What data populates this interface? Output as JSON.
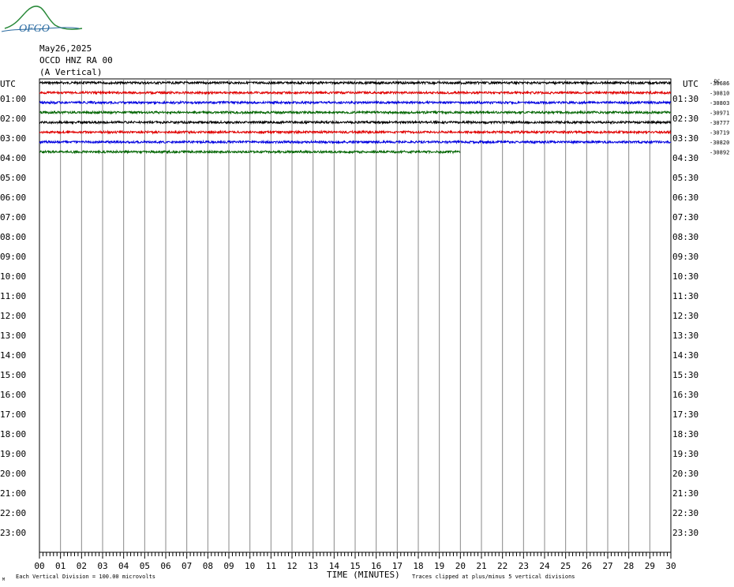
{
  "logo": {
    "text": "OFGO"
  },
  "header": {
    "date": "May26,2025",
    "station": "OCCD HNZ RA 00",
    "component": "(A Vertical)"
  },
  "labels": {
    "utc_left": "UTC",
    "utc_right": "UTC",
    "dc": "DC",
    "xaxis_title": "TIME (MINUTES)",
    "scale_note": "Each Vertical Division =  100.00 microvolts",
    "clip_note": "Traces clipped at plus/minus 5 vertical divisions",
    "corner_mark": "M"
  },
  "colors": {
    "grid": "#888888",
    "traces": [
      "#000000",
      "#e00000",
      "#0000e0",
      "#006400"
    ]
  },
  "chart_data": {
    "type": "line",
    "title": "",
    "xlabel": "TIME (MINUTES)",
    "xlim": [
      0,
      30
    ],
    "x_ticks": [
      "00",
      "01",
      "02",
      "03",
      "04",
      "05",
      "06",
      "07",
      "08",
      "09",
      "10",
      "11",
      "12",
      "13",
      "14",
      "15",
      "16",
      "17",
      "18",
      "19",
      "20",
      "21",
      "22",
      "23",
      "24",
      "25",
      "26",
      "27",
      "28",
      "29",
      "30"
    ],
    "left_row_labels": [
      "",
      "01:00",
      "02:00",
      "03:00",
      "04:00",
      "05:00",
      "06:00",
      "07:00",
      "08:00",
      "09:00",
      "10:00",
      "11:00",
      "12:00",
      "13:00",
      "14:00",
      "15:00",
      "16:00",
      "17:00",
      "18:00",
      "19:00",
      "20:00",
      "21:00",
      "22:00",
      "23:00"
    ],
    "right_row_labels": [
      "",
      "01:30",
      "02:30",
      "03:30",
      "04:30",
      "05:30",
      "06:30",
      "07:30",
      "08:30",
      "09:30",
      "10:30",
      "11:30",
      "12:30",
      "13:30",
      "14:30",
      "15:30",
      "16:30",
      "17:30",
      "18:30",
      "19:30",
      "20:30",
      "21:30",
      "22:30",
      "23:30"
    ],
    "traces": [
      {
        "row": 0,
        "color_index": 0,
        "dc": "-30686",
        "end_minute": 30
      },
      {
        "row": 1,
        "color_index": 1,
        "dc": "-30810",
        "end_minute": 30
      },
      {
        "row": 2,
        "color_index": 2,
        "dc": "-30803",
        "end_minute": 30
      },
      {
        "row": 3,
        "color_index": 3,
        "dc": "-30971",
        "end_minute": 30
      },
      {
        "row": 4,
        "color_index": 0,
        "dc": "-30777",
        "end_minute": 30
      },
      {
        "row": 5,
        "color_index": 1,
        "dc": "-30719",
        "end_minute": 30
      },
      {
        "row": 6,
        "color_index": 2,
        "dc": "-30820",
        "end_minute": 30
      },
      {
        "row": 7,
        "color_index": 3,
        "dc": "-30892",
        "end_minute": 20
      }
    ]
  }
}
